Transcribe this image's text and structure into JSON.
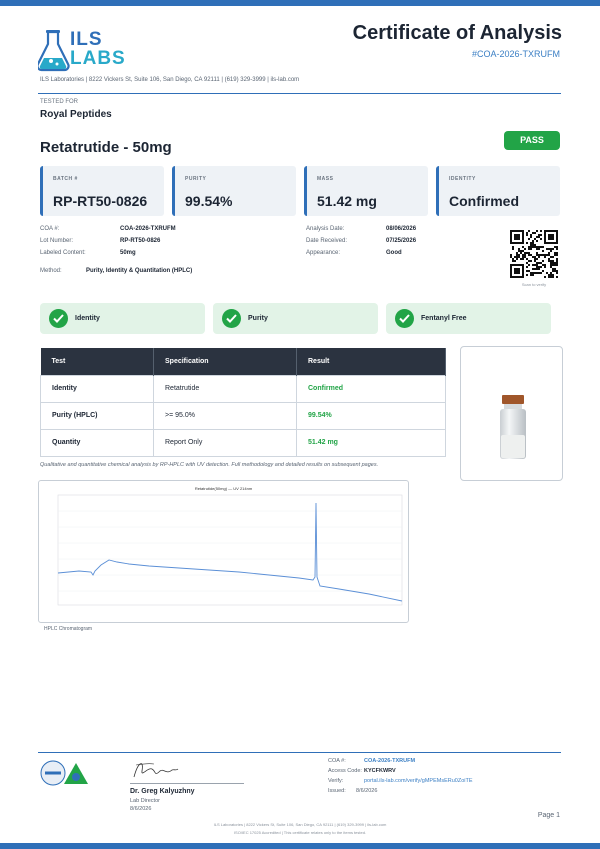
{
  "header": {
    "logo_line1": "ILS",
    "logo_line2": "LABS",
    "title": "Certificate of Analysis",
    "coa_id": "#COA-2026-TXRUFM",
    "address": "ILS Laboratories  |  8222 Vickers St, Suite 106, San Diego, CA 92111  |  (619) 329-3999  |  ils-lab.com"
  },
  "client": {
    "label": "TESTED FOR",
    "name": "Royal Peptides"
  },
  "product": {
    "name": "Retatrutide - 50mg",
    "status": "PASS",
    "status_color": "#22a447"
  },
  "summary": [
    {
      "key": "BATCH #",
      "value": "RP-RT50-0826"
    },
    {
      "key": "PURITY",
      "value": "99.54%"
    },
    {
      "key": "MASS",
      "value": "51.42 mg"
    },
    {
      "key": "IDENTITY",
      "value": "Confirmed"
    }
  ],
  "info_left": [
    {
      "label": "COA #:",
      "value": "COA-2026-TXRUFM"
    },
    {
      "label": "Lot Number:",
      "value": "RP-RT50-0826"
    },
    {
      "label": "Labeled Content:",
      "value": "50mg"
    }
  ],
  "info_right": [
    {
      "label": "Analysis Date:",
      "value": "08/06/2026"
    },
    {
      "label": "Date Received:",
      "value": "07/25/2026"
    },
    {
      "label": "Appearance:",
      "value": "Good"
    }
  ],
  "method": {
    "label": "Method:",
    "value": "Purity, Identity & Quantitation (HPLC)"
  },
  "qr_caption": "Scan to verify",
  "checks": [
    "Identity",
    "Purity",
    "Fentanyl Free"
  ],
  "results": {
    "headers": [
      "Test",
      "Specification",
      "Result"
    ],
    "rows": [
      {
        "test": "Identity",
        "spec": "Retatrutide",
        "result": "Confirmed"
      },
      {
        "test": "Purity (HPLC)",
        "spec": ">= 95.0%",
        "result": "99.54%"
      },
      {
        "test": "Quantity",
        "spec": "Report Only",
        "result": "51.42 mg"
      }
    ]
  },
  "note": "Qualitative and quantitative chemical analysis by RP-HPLC with UV detection. Full methodology and detailed results on subsequent pages.",
  "chromatogram": {
    "title": "Retatrutide(50mg) — UV 214nm",
    "caption": "HPLC Chromatogram"
  },
  "footer": {
    "director_name": "Dr. Greg Kalyuzhny",
    "director_role": "Lab Director",
    "director_date": "8/6/2026",
    "meta": [
      {
        "label": "COA #:",
        "value": "COA-2026-TXRUFM"
      },
      {
        "label": "Access Code:",
        "value": "KYCFKWRV"
      },
      {
        "label": "Verify:",
        "value": "portal.ils-lab.com/verify/gMPEMsERu0ZoiTE"
      },
      {
        "label": "Issued:",
        "value": "8/6/2026"
      }
    ],
    "page": "Page 1",
    "line1": "ILS Laboratories  |  8222 Vickers St, Suite 106, San Diego, CA 92111  |  (619) 329-3999  |  ils-lab.com",
    "line2": "ISO/IEC 17025 Accredited  |  This certificate relates only to the items tested."
  },
  "colors": {
    "accent": "#2f6fb8",
    "pass_green": "#22a447",
    "table_header": "#2b3340"
  }
}
